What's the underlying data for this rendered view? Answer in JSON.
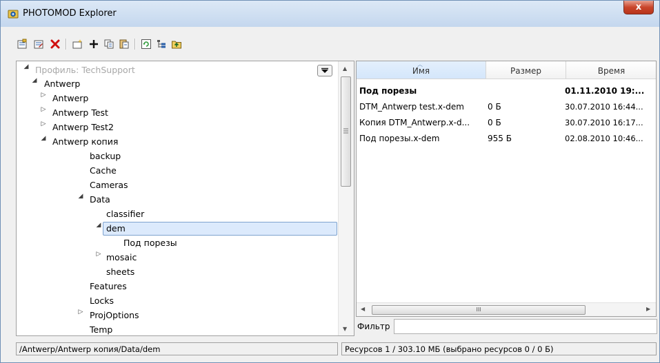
{
  "window": {
    "title": "PHOTOMOD Explorer",
    "close_label": "x"
  },
  "toolbar": {
    "buttons": [
      {
        "name": "properties-icon"
      },
      {
        "name": "edit-properties-icon"
      },
      {
        "name": "delete-icon"
      },
      {
        "name": "new-folder-icon"
      },
      {
        "name": "add-icon"
      },
      {
        "name": "copy-icon"
      },
      {
        "name": "paste-icon"
      },
      {
        "name": "refresh-icon"
      },
      {
        "name": "tree-view-icon"
      },
      {
        "name": "up-folder-icon"
      }
    ]
  },
  "tree": {
    "profile": "Профиль: TechSupport",
    "items": [
      {
        "label": "Antwerp"
      },
      {
        "label": "Antwerp"
      },
      {
        "label": "Antwerp Test"
      },
      {
        "label": "Antwerp Test2"
      },
      {
        "label": "Antwerp копия"
      },
      {
        "label": "backup"
      },
      {
        "label": "Cache"
      },
      {
        "label": "Cameras"
      },
      {
        "label": "Data"
      },
      {
        "label": "classifier"
      },
      {
        "label": "dem"
      },
      {
        "label": "Под порезы"
      },
      {
        "label": "mosaic"
      },
      {
        "label": "sheets"
      },
      {
        "label": "Features"
      },
      {
        "label": "Locks"
      },
      {
        "label": "ProjOptions"
      },
      {
        "label": "Temp"
      }
    ]
  },
  "files": {
    "columns": [
      "Имя",
      "Размер",
      "Время"
    ],
    "rows": [
      {
        "name": "Под порезы",
        "size": "",
        "time": "01.11.2010 19:..."
      },
      {
        "name": "DTM_Antwerp test.x-dem",
        "size": "0 Б",
        "time": "30.07.2010 16:44..."
      },
      {
        "name": "Копия DTM_Antwerp.x-d...",
        "size": "0 Б",
        "time": "30.07.2010 16:17..."
      },
      {
        "name": "Под порезы.x-dem",
        "size": "955 Б",
        "time": "02.08.2010 10:46..."
      }
    ],
    "hscroll_grip": "III"
  },
  "filter": {
    "label": "Фильтр",
    "value": ""
  },
  "status": {
    "path": "/Antwerp/Antwerp копия/Data/dem",
    "resources": "Ресурсов 1 / 303.10 МБ (выбрано ресурсов 0 / 0 Б)"
  }
}
